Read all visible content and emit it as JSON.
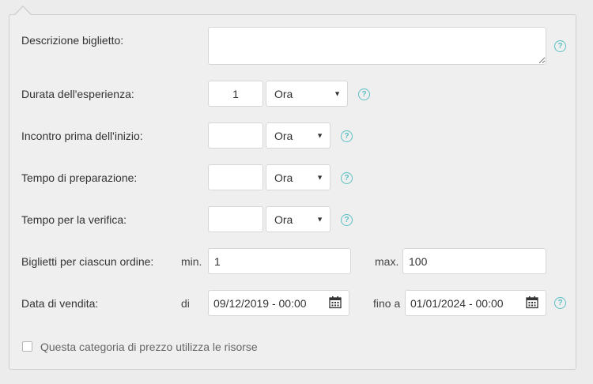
{
  "form": {
    "description": {
      "label": "Descrizione biglietto:",
      "value": ""
    },
    "duration": {
      "label": "Durata dell'esperienza:",
      "number": "1",
      "unit": "Ora"
    },
    "meeting": {
      "label": "Incontro prima dell'inizio:",
      "number": "",
      "unit": "Ora"
    },
    "preparation": {
      "label": "Tempo di preparazione:",
      "number": "",
      "unit": "Ora"
    },
    "verification": {
      "label": "Tempo per la verifica:",
      "number": "",
      "unit": "Ora"
    },
    "tickets": {
      "label": "Biglietti per ciascun ordine:",
      "min_label": "min.",
      "min_value": "1",
      "max_label": "max.",
      "max_value": "100"
    },
    "sale_date": {
      "label": "Data di vendita:",
      "from_label": "di",
      "from_value": "09/12/2019 - 00:00",
      "to_label": "fino a",
      "to_value": "01/01/2024 - 00:00"
    },
    "resources": {
      "label": "Questa categoria di prezzo utilizza le risorse",
      "checked": false
    },
    "help_glyph": "?",
    "select_arrow": "▼"
  },
  "icons": [
    "help-icon",
    "calendar-icon",
    "chevron-down-icon"
  ],
  "colors": {
    "help": "#5bc0c5",
    "panel": "#efefef",
    "border": "#cfcfcf"
  }
}
